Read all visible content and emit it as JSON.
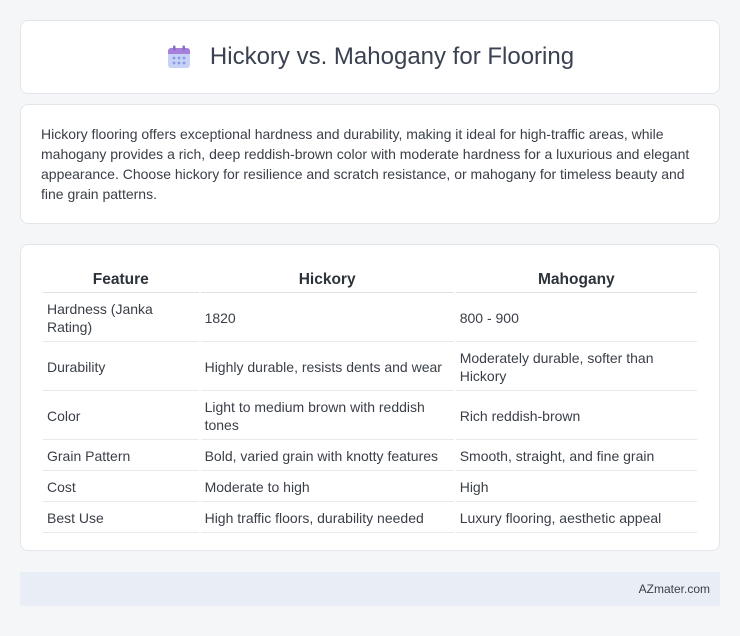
{
  "header": {
    "title": "Hickory vs. Mahogany for Flooring",
    "icon": "calendar-icon",
    "icon_colors": {
      "top": "#a77bd9",
      "body": "#b9c7f5",
      "dots": "#8e9be8"
    }
  },
  "summary": {
    "text": "Hickory flooring offers exceptional hardness and durability, making it ideal for high-traffic areas, while mahogany provides a rich, deep reddish-brown color with moderate hardness for a luxurious and elegant appearance. Choose hickory for resilience and scratch resistance, or mahogany for timeless beauty and fine grain patterns."
  },
  "table": {
    "headers": [
      "Feature",
      "Hickory",
      "Mahogany"
    ],
    "rows": [
      {
        "feature": "Hardness (Janka Rating)",
        "hickory": "1820",
        "mahogany": "800 - 900"
      },
      {
        "feature": "Durability",
        "hickory": "Highly durable, resists dents and wear",
        "mahogany": "Moderately durable, softer than Hickory"
      },
      {
        "feature": "Color",
        "hickory": "Light to medium brown with reddish tones",
        "mahogany": "Rich reddish-brown"
      },
      {
        "feature": "Grain Pattern",
        "hickory": "Bold, varied grain with knotty features",
        "mahogany": "Smooth, straight, and fine grain"
      },
      {
        "feature": "Cost",
        "hickory": "Moderate to high",
        "mahogany": "High"
      },
      {
        "feature": "Best Use",
        "hickory": "High traffic floors, durability needed",
        "mahogany": "Luxury flooring, aesthetic appeal"
      }
    ]
  },
  "footer": {
    "text": "AZmater.com"
  }
}
